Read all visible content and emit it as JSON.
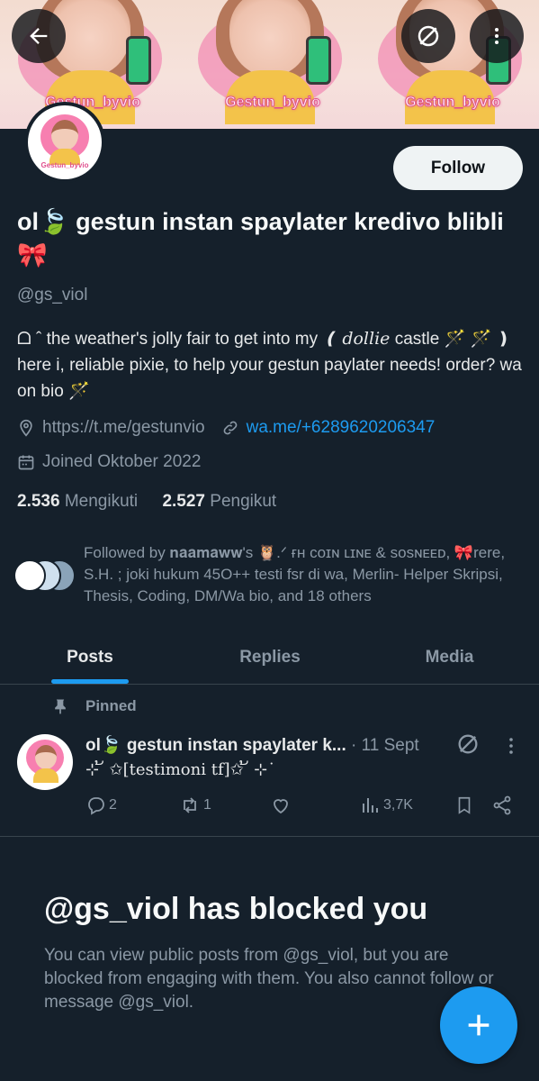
{
  "banner": {
    "tile_label": "Gestun_byvio"
  },
  "header": {
    "back_icon": "back-arrow-icon",
    "block_icon": "blocked-icon",
    "more_icon": "more-vertical-icon"
  },
  "profile": {
    "avatar_label": "Gestun_byvio",
    "follow_label": "Follow",
    "name": "ol🍃 gestun instan spaylater kredivo blibli 🎀",
    "handle": "@gs_viol",
    "bio_1": "ᗝ ˆ the weather's jolly fair to get into my ",
    "bio_ital": "❪ dollie",
    "bio_2": " castle 🪄 🪄 ❫ here i, reliable pixie, to help your gestun paylater needs! order? wa on bio 🪄",
    "url1": "https://t.me/gestunvio",
    "url2": "wa.me/+6289620206347",
    "joined": "Joined Oktober 2022",
    "following_count": "2.536",
    "following_label": "Mengikuti",
    "followers_count": "2.527",
    "followers_label": "Pengikut",
    "followed_by": "Followed by 𝐧𝐚𝐚𝐦𝐚𝐰𝐰's 🦉.ᐟ ғʜ ᴄᴏɪɴ ʟɪɴᴇ & sᴏsɴᴇᴇᴅ, 🎀rere, S.H. ; joki hukum 45O++ testi fsr di wa, Merlin- Helper Skripsi, Thesis, Coding, DM/Wa bio, and 18 others"
  },
  "tabs": [
    "Posts",
    "Replies",
    "Media"
  ],
  "post": {
    "pinned_label": "Pinned",
    "author": "ol🍃 gestun instan spaylater k...",
    "date": "· 11 Sept",
    "text": "⊹ ້ ✩[testimoni tf]✩ ້ ⊹˙",
    "replies": "2",
    "reposts": "1",
    "likes": "",
    "views": "3,7K"
  },
  "blocked": {
    "title": "@gs_viol has blocked you",
    "text": "You can view public posts from @gs_viol, but you are blocked from engaging with them. You also cannot follow or message @gs_viol."
  },
  "colors": {
    "background": "#15202b",
    "accent": "#1d9bf0",
    "muted": "#8b98a5"
  }
}
